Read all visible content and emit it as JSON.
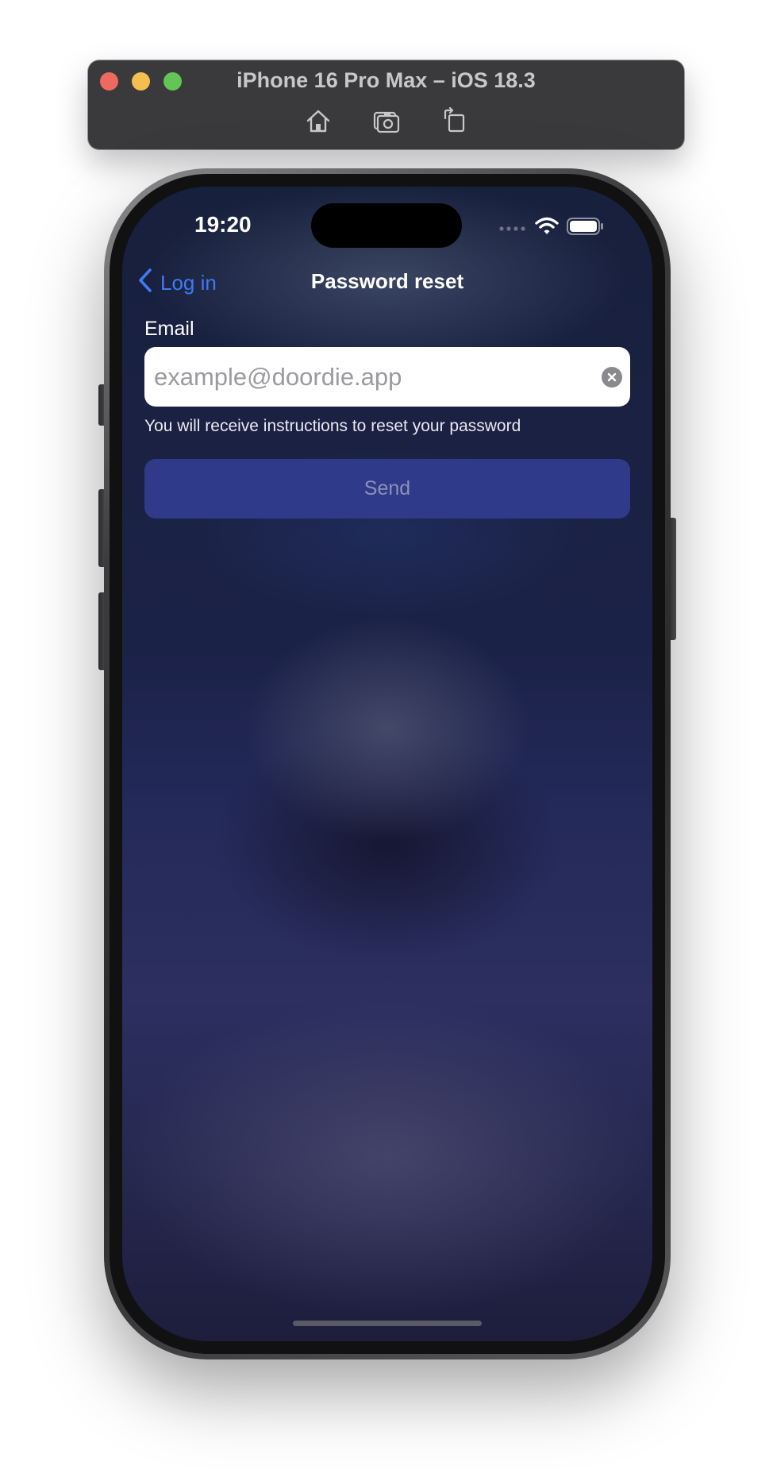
{
  "simulator": {
    "title": "iPhone 16 Pro Max – iOS 18.3",
    "tools": [
      "home-icon",
      "screenshot-icon",
      "rotate-icon"
    ]
  },
  "status_bar": {
    "time": "19:20"
  },
  "nav": {
    "back_label": "Log in",
    "title": "Password reset"
  },
  "form": {
    "email_label": "Email",
    "email_value": "",
    "email_placeholder": "example@doordie.app",
    "hint": "You will receive instructions to reset your password",
    "send_label": "Send"
  },
  "colors": {
    "accent": "#3d7bf5",
    "send_button": "#2f3a8a",
    "send_text_disabled": "#8c92b6"
  }
}
